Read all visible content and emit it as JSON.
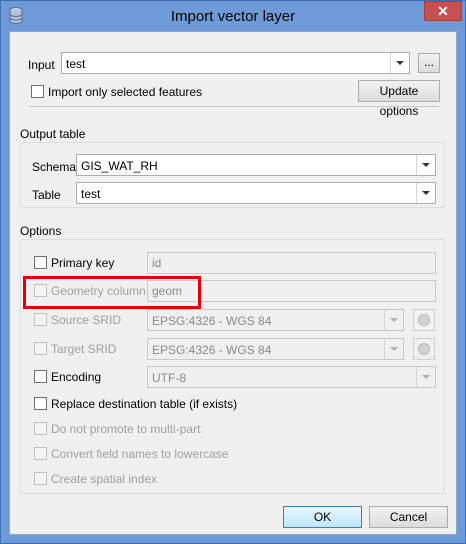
{
  "window": {
    "title": "Import vector layer",
    "close_glyph": "✕"
  },
  "input": {
    "label": "Input",
    "value": "test",
    "browse_label": "...",
    "selected_only_label": "Import only selected features",
    "selected_only_checked": false,
    "update_label": "Update options"
  },
  "output": {
    "section_label": "Output table",
    "schema_label": "Schema",
    "schema_value": "GIS_WAT_RH",
    "table_label": "Table",
    "table_value": "test"
  },
  "options": {
    "section_label": "Options",
    "primary_key": {
      "label": "Primary key",
      "value": "id",
      "checked": false,
      "enabled": true
    },
    "geometry_column": {
      "label": "Geometry column",
      "value": "geom",
      "checked": false,
      "enabled": false,
      "highlighted": true
    },
    "source_srid": {
      "label": "Source SRID",
      "value": "EPSG:4326 - WGS 84",
      "checked": false,
      "enabled": false
    },
    "target_srid": {
      "label": "Target SRID",
      "value": "EPSG:4326 - WGS 84",
      "checked": false,
      "enabled": false
    },
    "encoding": {
      "label": "Encoding",
      "value": "UTF-8",
      "checked": false,
      "enabled": true
    },
    "replace": {
      "label": "Replace destination table (if exists)",
      "checked": false,
      "enabled": true
    },
    "no_multipart": {
      "label": "Do not promote to multi-part",
      "checked": false,
      "enabled": false
    },
    "lowercase": {
      "label": "Convert field names to lowercase",
      "checked": false,
      "enabled": false
    },
    "spatial_index": {
      "label": "Create spatial index",
      "checked": false,
      "enabled": false
    }
  },
  "buttons": {
    "ok": "OK",
    "cancel": "Cancel"
  },
  "icons": {
    "app": "database-icon",
    "crs": "globe-icon"
  },
  "colors": {
    "titlebar": "#6e9bd8",
    "close": "#c75050",
    "highlight": "#e00000"
  }
}
